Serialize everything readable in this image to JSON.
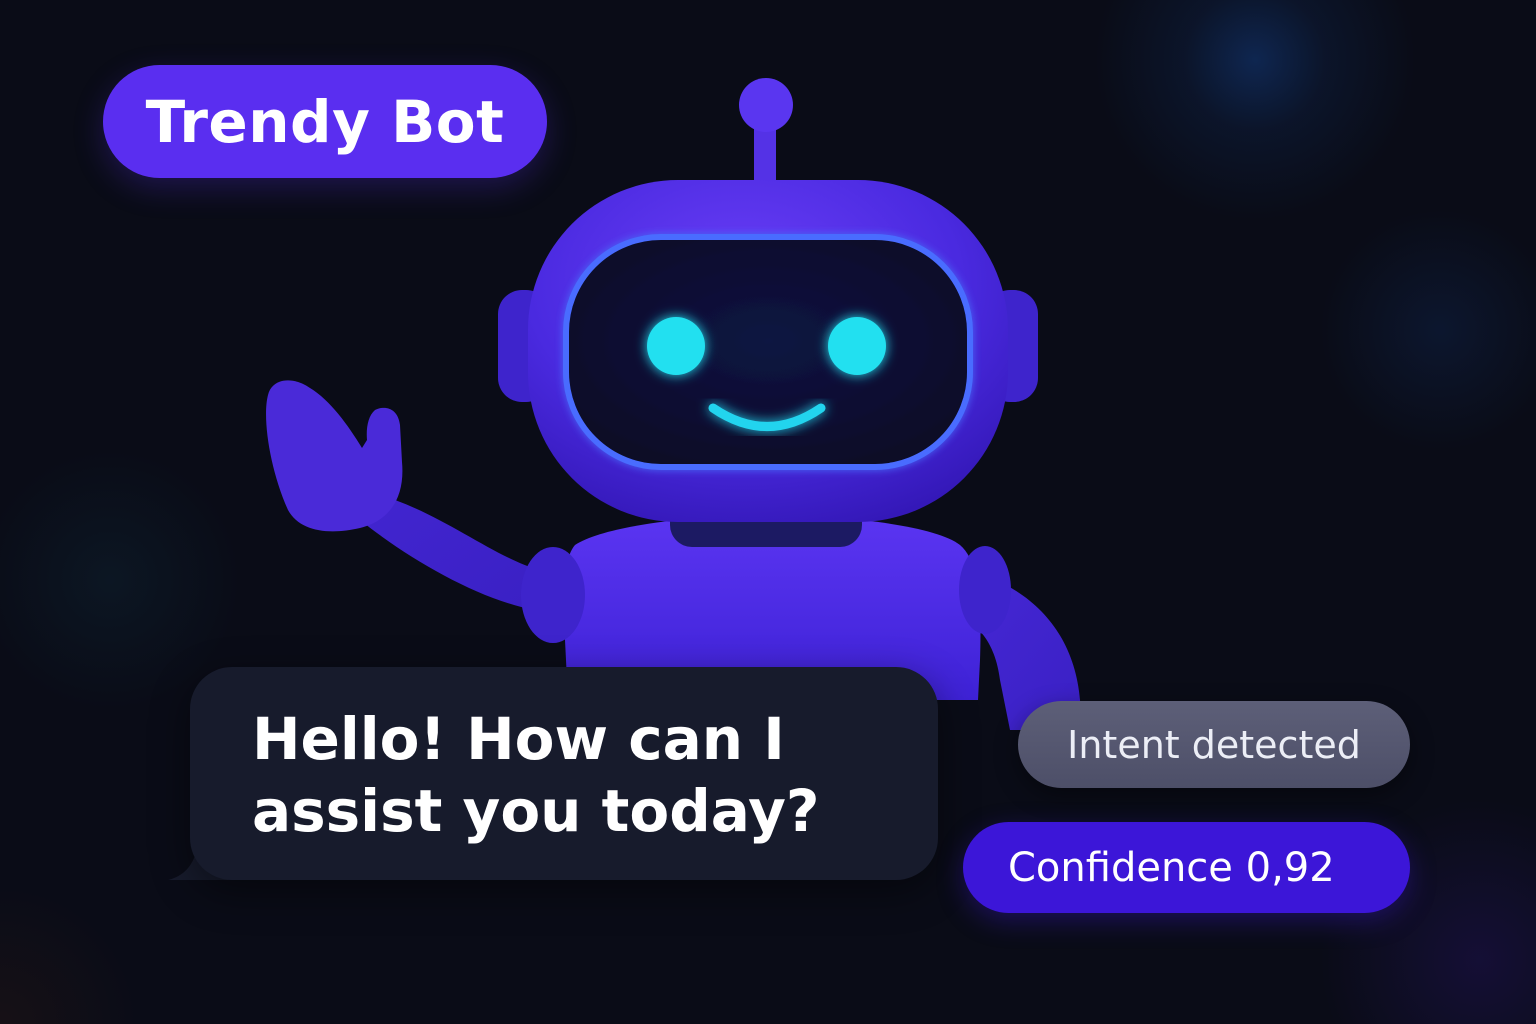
{
  "header": {
    "title": "Trendy Bot"
  },
  "chat": {
    "message": "Hello! How can I\nassist you today?"
  },
  "status": {
    "intent_label": "Intent detected",
    "confidence_label": "Confidence",
    "confidence_value": "0,92"
  },
  "colors": {
    "accent": "#5a2ef0",
    "accent_dark": "#3c16d8",
    "robot_body": "#4a2ee6",
    "eyes": "#22e0f0",
    "background": "#0a0c17",
    "bubble": "#171b2c",
    "intent_pill": "#55576f"
  },
  "icons": {
    "mascot": "robot-mascot-icon"
  }
}
